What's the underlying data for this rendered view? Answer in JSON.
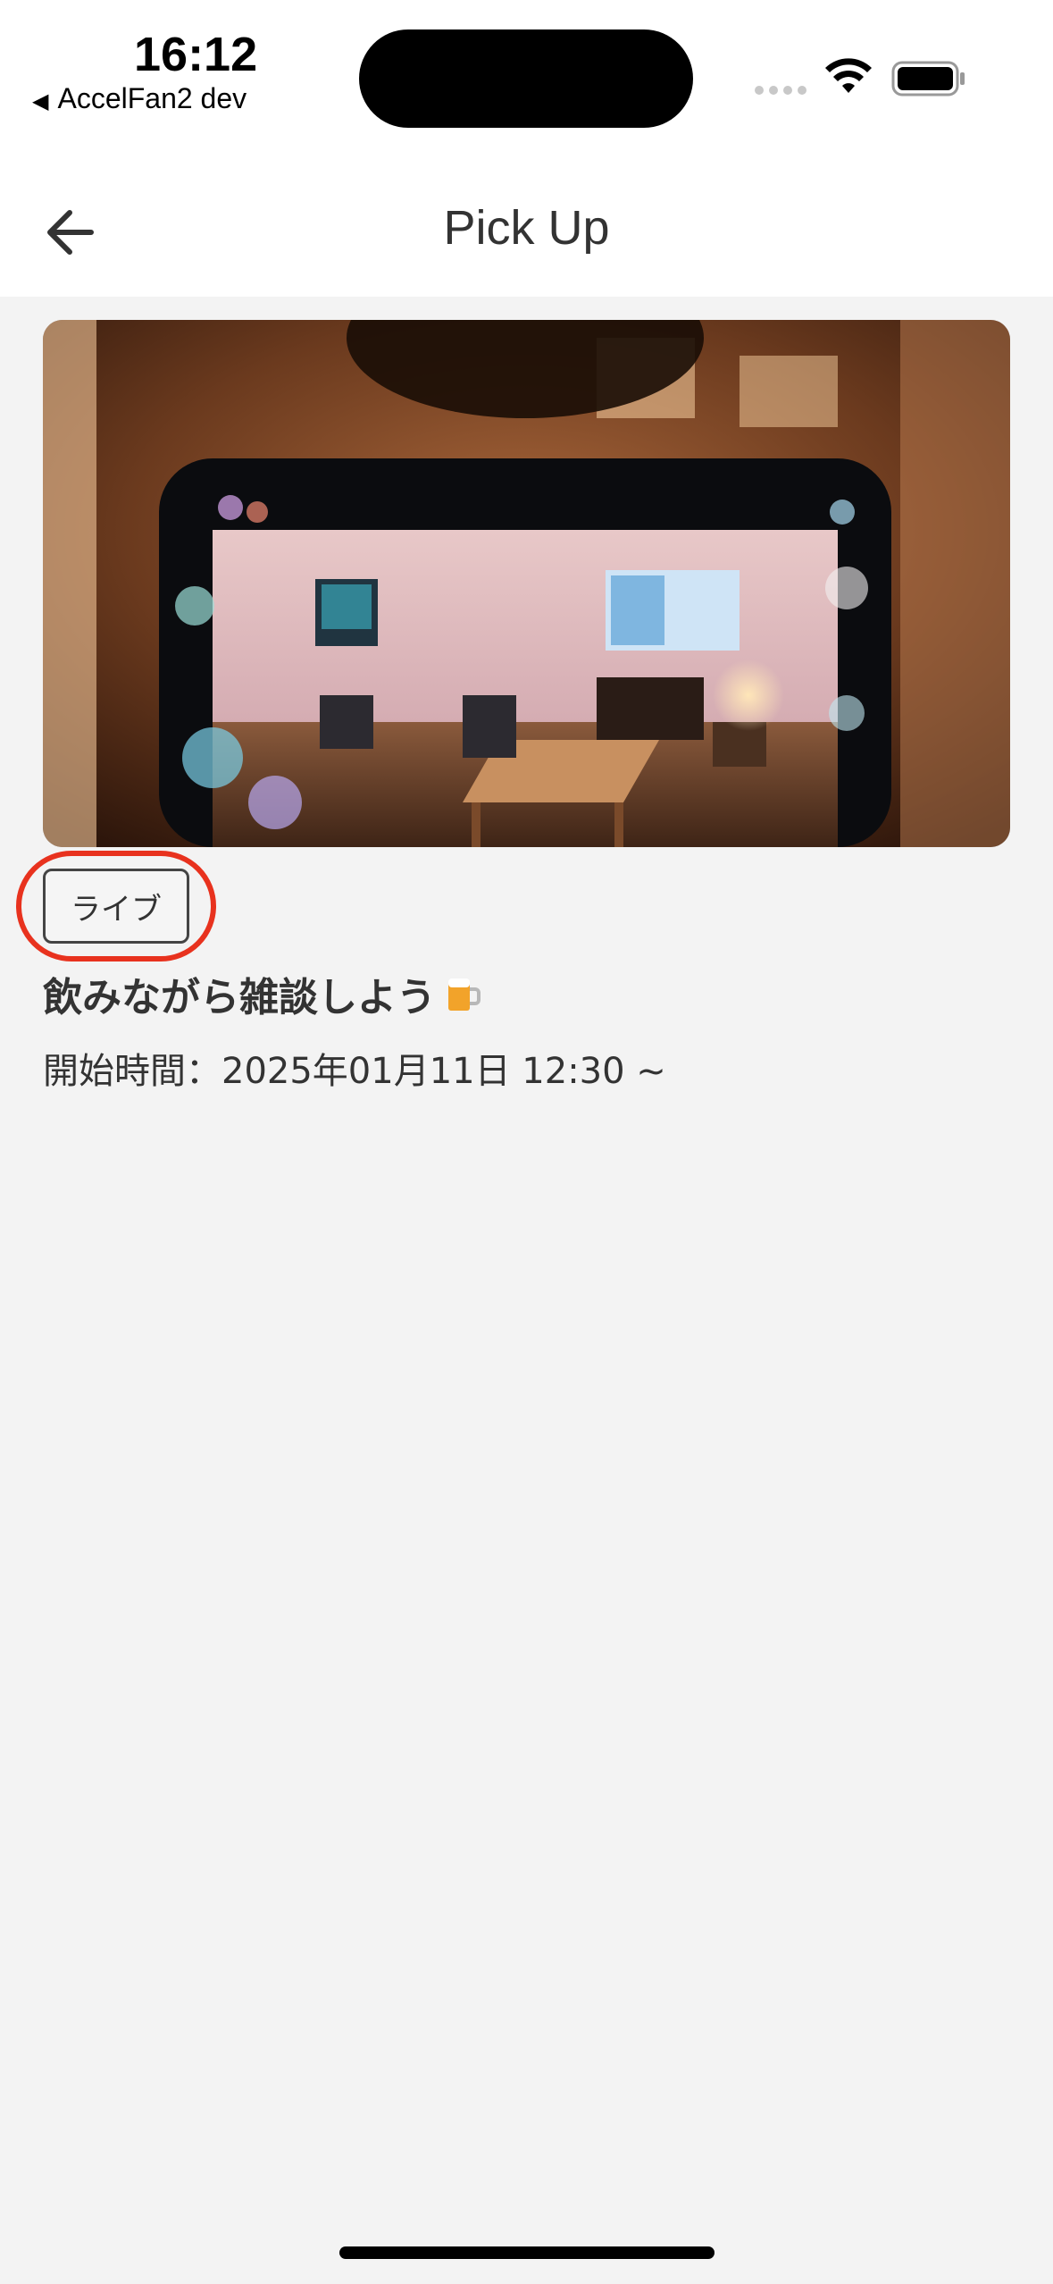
{
  "status_bar": {
    "time": "16:12",
    "back_app_label": "AccelFan2 dev",
    "back_app_arrow": "◀"
  },
  "header": {
    "title": "Pick Up",
    "back_icon": "arrow-left-icon"
  },
  "event": {
    "image_alt": "Room viewed through a smartphone camera screen",
    "badge_label": "ライブ",
    "title": "飲みながら雑談しよう",
    "title_emoji": "beer-mug-icon",
    "start_time": "開始時間：2025年01月11日 12:30 ~"
  },
  "colors": {
    "highlight_ring": "#e8321e",
    "background": "#f3f3f3",
    "header_bg": "#ffffff",
    "text": "#333333"
  }
}
